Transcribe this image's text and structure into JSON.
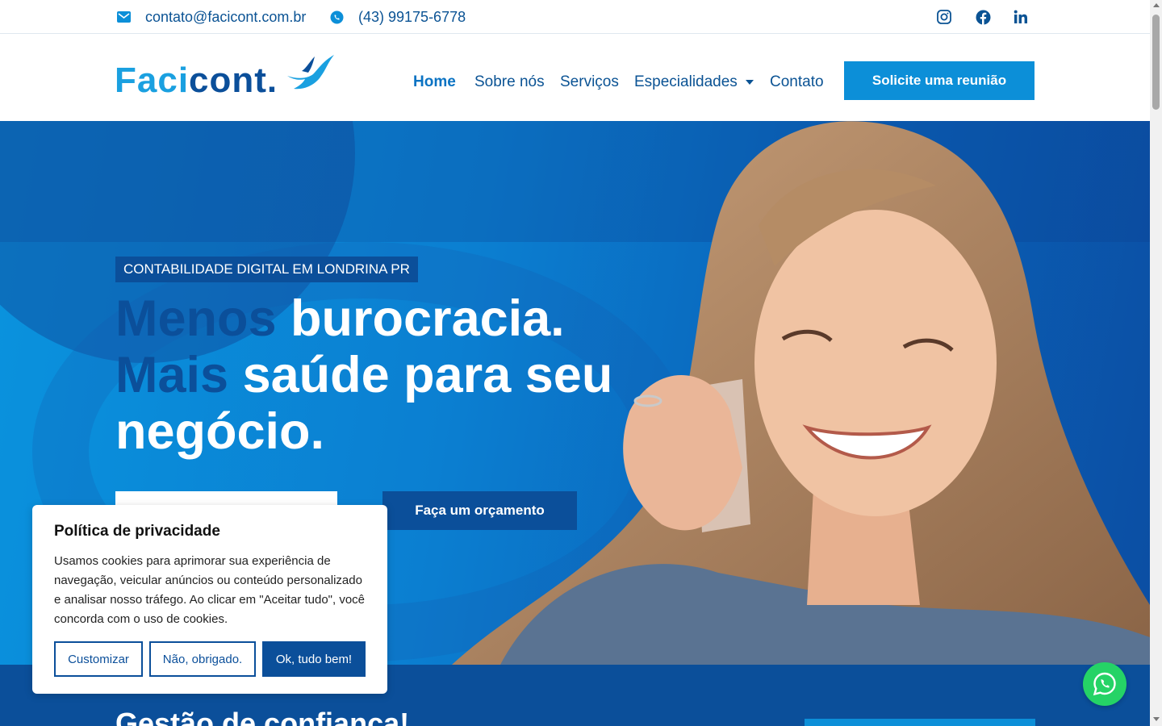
{
  "topbar": {
    "email": "contato@facicont.com.br",
    "phone": "(43) 99175-6778",
    "icons": [
      "email-icon",
      "whatsapp-icon",
      "instagram-icon",
      "facebook-icon",
      "linkedin-icon"
    ]
  },
  "header": {
    "logo_part1": "Faci",
    "logo_part2": "cont.",
    "nav": [
      {
        "label": "Home",
        "active": true
      },
      {
        "label": "Sobre nós"
      },
      {
        "label": "Serviços"
      },
      {
        "label": "Especialidades",
        "has_dropdown": true
      },
      {
        "label": "Contato"
      }
    ],
    "cta": "Solicite uma reunião"
  },
  "hero": {
    "tag": "CONTABILIDADE DIGITAL EM LONDRINA PR",
    "headline": {
      "w1": "Menos",
      "w2": "burocracia.",
      "w3": "Mais",
      "w4": "saúde para seu negócio."
    },
    "button_quote": "Faça um orçamento"
  },
  "section": {
    "title": "Gestão de confiança!"
  },
  "cookie": {
    "title": "Política de privacidade",
    "text": "Usamos cookies para aprimorar sua experiência de navegação, veicular anúncios ou conteúdo personalizado e analisar nosso tráfego. Ao clicar em \"Aceitar tudo\", você concorda com o uso de cookies.",
    "btn_customize": "Customizar",
    "btn_reject": "Não, obrigado.",
    "btn_accept": "Ok, tudo bem!"
  },
  "colors": {
    "primary": "#0b4f9a",
    "accent": "#0c8fd8",
    "whatsapp": "#25d366"
  }
}
